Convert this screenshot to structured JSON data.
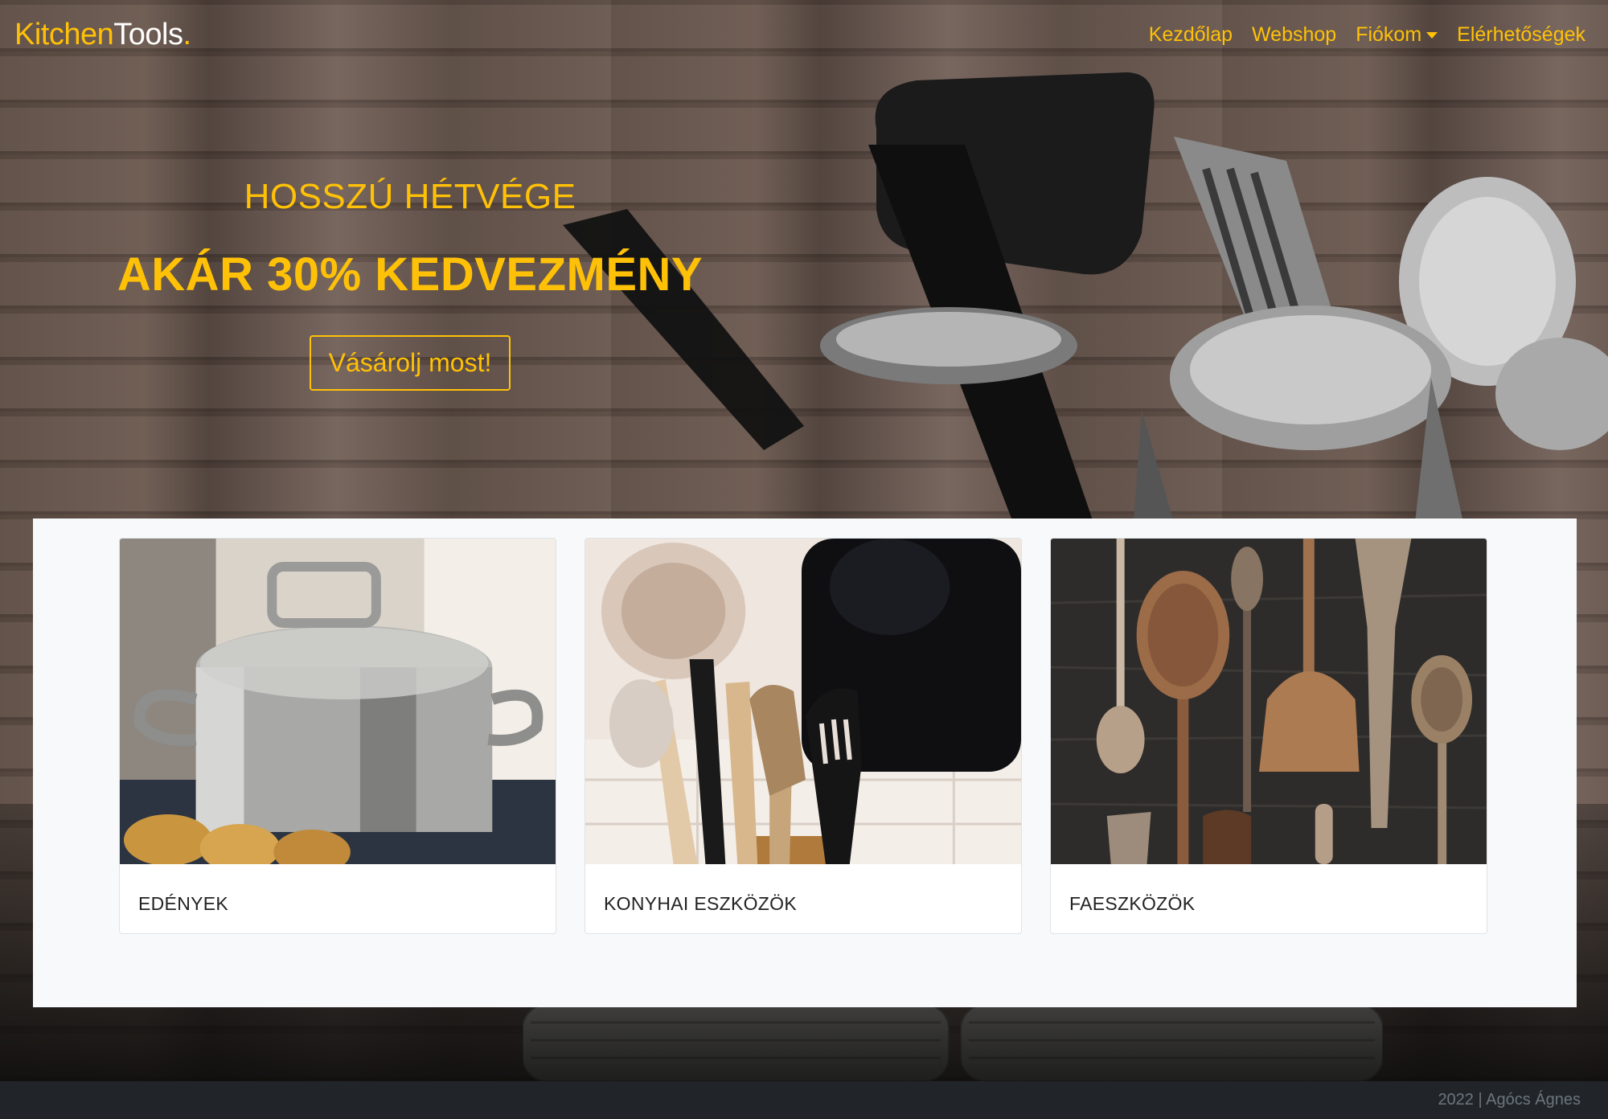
{
  "brand": {
    "part1": "Kitchen",
    "part2": "Tools",
    "dot": "."
  },
  "nav": {
    "items": [
      {
        "label": "Kezdőlap"
      },
      {
        "label": "Webshop"
      },
      {
        "label": "Fiókom"
      },
      {
        "label": "Elérhetőségek"
      }
    ],
    "dropdown_icon": "caret-down-icon"
  },
  "hero": {
    "subtitle": "HOSSZÚ HÉTVÉGE",
    "title": "AKÁR 30% KEDVEZMÉNY",
    "button": "Vásárolj most!"
  },
  "categories": [
    {
      "title": "EDÉNYEK"
    },
    {
      "title": "KONYHAI ESZKÖZÖK"
    },
    {
      "title": "FAESZKÖZÖK"
    }
  ],
  "footer": {
    "text": "2022 | Agócs Ágnes"
  },
  "colors": {
    "accent": "#ffc107",
    "footer_bg": "#212529",
    "panel_bg": "#f8f9fa"
  }
}
